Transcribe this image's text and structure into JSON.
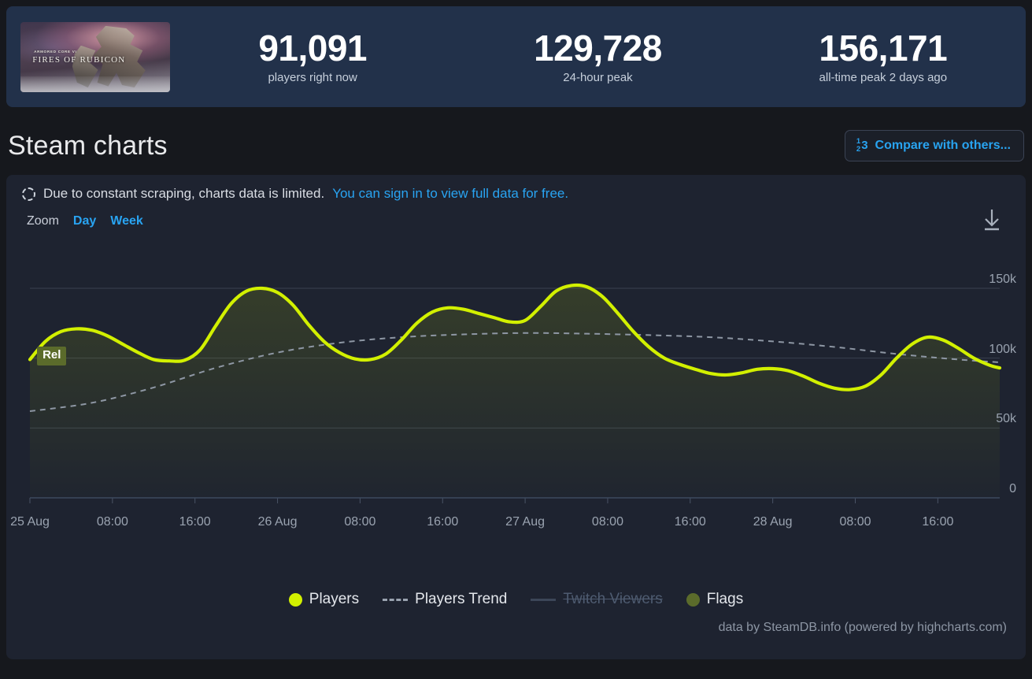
{
  "colors": {
    "page_bg": "#16181d",
    "stats_panel_bg": "#22314a",
    "card_bg": "#1e2330",
    "accent_link": "#29a4f2",
    "players_line": "#d2f000",
    "trend_line": "#9aa3b0",
    "flag_bg": "#5b6b2b",
    "grid": "#3a4250"
  },
  "header": {
    "game": {
      "title_small": "ARMORED CORE VI",
      "title_main": "FIRES OF RUBICON",
      "thumb_icon": "game-cover-art"
    },
    "stats": [
      {
        "value": "91,091",
        "label": "players right now"
      },
      {
        "value": "129,728",
        "label": "24-hour peak"
      },
      {
        "value": "156,171",
        "label": "all-time peak 2 days ago"
      }
    ]
  },
  "section": {
    "title": "Steam charts",
    "compare_button": {
      "label": "Compare with others...",
      "icon": "compare-numbers-icon",
      "icon_parts": {
        "top": "1",
        "bottom": "2",
        "right": "3"
      }
    }
  },
  "notice": {
    "icon": "loading-spinner-icon",
    "text": "Due to constant scraping, charts data is limited.",
    "link_text": "You can sign in to view full data for free."
  },
  "toolbar": {
    "zoom_label": "Zoom",
    "ranges": [
      {
        "label": "Day",
        "active": true
      },
      {
        "label": "Week",
        "active": false
      }
    ],
    "download_icon": "download-icon"
  },
  "legend": [
    {
      "label": "Players",
      "marker": "dot",
      "color": "#d2f000",
      "enabled": true
    },
    {
      "label": "Players Trend",
      "marker": "dashed-line",
      "color": "#9aa3b0",
      "enabled": true
    },
    {
      "label": "Twitch Viewers",
      "marker": "solid-line",
      "color": "#3c4658",
      "enabled": false
    },
    {
      "label": "Flags",
      "marker": "dot",
      "color": "#5b6b2b",
      "enabled": true
    }
  ],
  "credit": "data by SteamDB.info (powered by highcharts.com)",
  "flags": [
    {
      "label": "Rel",
      "x_index": 1
    }
  ],
  "chart_data": {
    "type": "area",
    "title": "Steam charts",
    "xlabel": "",
    "ylabel": "",
    "ylim": [
      0,
      180000
    ],
    "grid": true,
    "legend_position": "bottom",
    "y_ticks": [
      {
        "value": 0,
        "label": "0"
      },
      {
        "value": 50000,
        "label": "50k"
      },
      {
        "value": 100000,
        "label": "100k"
      },
      {
        "value": 150000,
        "label": "150k"
      }
    ],
    "x_ticks": [
      "25 Aug",
      "08:00",
      "16:00",
      "26 Aug",
      "08:00",
      "16:00",
      "27 Aug",
      "08:00",
      "16:00",
      "28 Aug",
      "08:00",
      "16:00"
    ],
    "x_tick_positions": [
      0,
      8,
      16,
      24,
      32,
      40,
      48,
      56,
      64,
      72,
      80,
      88
    ],
    "x_range_hours": [
      0,
      94
    ],
    "series": [
      {
        "name": "Players",
        "type": "area",
        "color": "#d2f000",
        "x": [
          0,
          1.5,
          3,
          4.5,
          6,
          7.5,
          9,
          10.5,
          12,
          13.5,
          15,
          16.5,
          18,
          19.5,
          21,
          22.5,
          24,
          25.5,
          27,
          28.5,
          30,
          31.5,
          33,
          34.5,
          36,
          37.5,
          39,
          40.5,
          42,
          43.5,
          45,
          46.5,
          48,
          49.5,
          51,
          52.5,
          54,
          55.5,
          57,
          58.5,
          60,
          61.5,
          63,
          64.5,
          66,
          67.5,
          69,
          70.5,
          72,
          73.5,
          75,
          76.5,
          78,
          79.5,
          81,
          82.5,
          84,
          85.5,
          87,
          88.5,
          90,
          91.5,
          93,
          94
        ],
        "values": [
          99000,
          112000,
          119000,
          121000,
          120000,
          116000,
          110000,
          104000,
          99000,
          98000,
          98500,
          106000,
          123000,
          139000,
          148000,
          150000,
          147000,
          138000,
          124000,
          112000,
          104000,
          99500,
          99000,
          103000,
          113000,
          125000,
          133000,
          136000,
          135000,
          132000,
          129000,
          126000,
          127000,
          137000,
          148000,
          152000,
          151000,
          144000,
          132000,
          119000,
          108000,
          100000,
          95500,
          92000,
          89000,
          88000,
          89500,
          92000,
          92500,
          91000,
          87000,
          82000,
          78500,
          77500,
          80000,
          88000,
          100000,
          110000,
          115000,
          113000,
          107000,
          100000,
          95000,
          93000
        ]
      },
      {
        "name": "Players Trend",
        "type": "line",
        "style": "dashed",
        "color": "#9aa3b0",
        "x": [
          0,
          6,
          12,
          18,
          24,
          30,
          36,
          42,
          48,
          54,
          60,
          66,
          72,
          78,
          84,
          90,
          94
        ],
        "values": [
          62000,
          68000,
          79000,
          93000,
          104000,
          111000,
          115000,
          117000,
          118000,
          117500,
          116500,
          115000,
          112000,
          108000,
          103000,
          99000,
          97000
        ]
      },
      {
        "name": "Twitch Viewers",
        "type": "line",
        "color": "#3c4658",
        "enabled": false,
        "x": [],
        "values": []
      }
    ]
  }
}
